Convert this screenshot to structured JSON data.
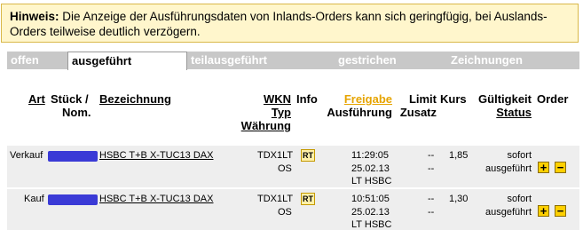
{
  "notice": {
    "label": "Hinweis:",
    "text": " Die Anzeige der Ausführungsdaten von Inlands-Orders kann sich geringfügig, bei Auslands-Orders teilweise deutlich verzögern."
  },
  "tabs": [
    {
      "label": "offen"
    },
    {
      "label": "ausgeführt"
    },
    {
      "label": "teilausgeführt"
    },
    {
      "label": "gestrichen"
    },
    {
      "label": "Zeichnungen"
    }
  ],
  "active_tab": "ausgeführt",
  "headers": {
    "art": "Art",
    "stueck": "Stück /",
    "nom": "Nom.",
    "bezeichnung": "Bezeichnung",
    "wkn": "WKN",
    "typ": "Typ",
    "waehrung": "Währung",
    "info": "Info",
    "freigabe": "Freigabe",
    "ausfuehrung": "Ausführung",
    "limit": "Limit",
    "zusatz": "Zusatz",
    "kurs": "Kurs",
    "gueltigkeit": "Gültigkeit",
    "status": "Status",
    "order": "Order"
  },
  "rows": [
    {
      "art": "Verkauf",
      "bezeichnung": "HSBC T+B X-TUC13 DAX",
      "wkn_line1": "TDX1LT",
      "wkn_line2": "OS",
      "info": "RT",
      "time": "11:29:05",
      "date": "25.02.13",
      "venue": "LT HSBC",
      "limit": "--",
      "zusatz": "--",
      "kurs": "1,85",
      "gueltigkeit": "sofort",
      "status": "ausgeführt",
      "plus": "+",
      "minus": "−"
    },
    {
      "art": "Kauf",
      "bezeichnung": "HSBC T+B X-TUC13 DAX",
      "wkn_line1": "TDX1LT",
      "wkn_line2": "OS",
      "info": "RT",
      "time": "10:51:05",
      "date": "25.02.13",
      "venue": "LT HSBC",
      "limit": "--",
      "zusatz": "--",
      "kurs": "1,30",
      "gueltigkeit": "sofort",
      "status": "ausgeführt",
      "plus": "+",
      "minus": "−"
    }
  ]
}
